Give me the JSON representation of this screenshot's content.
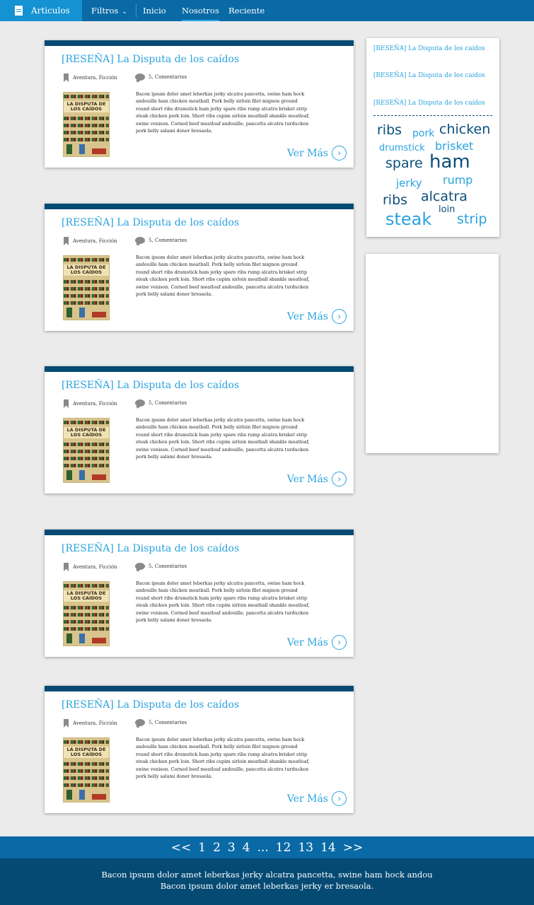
{
  "nav": {
    "brand": "Articulos",
    "filters": "Filtros",
    "items": [
      "Inicio",
      "Nosotros",
      "Reciente"
    ],
    "active": "Nosotros",
    "icons": {
      "brand": "document-icon",
      "filters": "chevron-down-icon"
    }
  },
  "posts": [
    {
      "title": "[RESEÑA] La Disputa de los caídos",
      "category": "Aventura, Ficción",
      "comments": "5, Comentarios",
      "cover_title": "LA DISPUTA DE LOS CAÍDOS",
      "excerpt": "Bacon ipsum dolor amet leberkas jerky alcatra pancetta, swine ham hock andouille ham chicken meatball. Pork belly sirloin filet mignon ground round short ribs drumstick ham jerky spare ribs rump alcatra brisket strip steak chicken pork loin. Short ribs cupim sirloin meatball shankle meatloaf, swine venison. Corned beef meatloaf andouille, pancetta alcatra turducken pork belly salami doner bresaola.",
      "more": "Ver Más"
    },
    {
      "title": "[RESEÑA] La Disputa de los caídos",
      "category": "Aventura, Ficción",
      "comments": "5, Comentarios",
      "cover_title": "LA DISPUTA DE LOS CAÍDOS",
      "excerpt": "Bacon ipsum dolor amet leberkas jerky alcatra pancetta, swine ham hock andouille ham chicken meatball. Pork belly sirloin filet mignon ground round short ribs drumstick ham jerky spare ribs rump alcatra brisket strip steak chicken pork loin. Short ribs cupim sirloin meatball shankle meatloaf, swine venison. Corned beef meatloaf andouille, pancetta alcatra turducken pork belly salami doner bresaola.",
      "more": "Ver Más"
    },
    {
      "title": "[RESEÑA] La Disputa de los caídos",
      "category": "Aventura, Ficción",
      "comments": "5, Comentarios",
      "cover_title": "LA DISPUTA DE LOS CAÍDOS",
      "excerpt": "Bacon ipsum dolor amet leberkas jerky alcatra pancetta, swine ham hock andouille ham chicken meatball. Pork belly sirloin filet mignon ground round short ribs drumstick ham jerky spare ribs rump alcatra brisket strip steak chicken pork loin. Short ribs cupim sirloin meatball shankle meatloaf, swine venison. Corned beef meatloaf andouille, pancetta alcatra turducken pork belly salami doner bresaola.",
      "more": "Ver Más"
    },
    {
      "title": "[RESEÑA] La Disputa de los caídos",
      "category": "Aventura, Ficción",
      "comments": "5, Comentarios",
      "cover_title": "LA DISPUTA DE LOS CAÍDOS",
      "excerpt": "Bacon ipsum dolor amet leberkas jerky alcatra pancetta, swine ham hock andouille ham chicken meatball. Pork belly sirloin filet mignon ground round short ribs drumstick ham jerky spare ribs rump alcatra brisket strip steak chicken pork loin. Short ribs cupim sirloin meatball shankle meatloaf, swine venison. Corned beef meatloaf andouille, pancetta alcatra turducken pork belly salami doner bresaola.",
      "more": "Ver Más"
    },
    {
      "title": "[RESEÑA] La Disputa de los caídos",
      "category": "Aventura, Ficción",
      "comments": "5, Comentarios",
      "cover_title": "LA DISPUTA DE LOS CAÍDOS",
      "excerpt": "Bacon ipsum dolor amet leberkas jerky alcatra pancetta, swine ham hock andouille ham chicken meatball. Pork belly sirloin filet mignon ground round short ribs drumstick ham jerky spare ribs rump alcatra brisket strip steak chicken pork loin. Short ribs cupim sirloin meatball shankle meatloaf, swine venison. Corned beef meatloaf andouille, pancetta alcatra turducken pork belly salami doner bresaola.",
      "more": "Ver Más"
    }
  ],
  "sidebar": {
    "recent": [
      "[RESEÑA] La Disputa de los caídos",
      "[RESEÑA] La Disputa de los caídos",
      "[RESEÑA] La Disputa de los caídos"
    ],
    "tags": [
      "ribs",
      "pork",
      "chicken",
      "drumstick",
      "brisket",
      "spare",
      "ham",
      "jerky",
      "rump",
      "ribs",
      "alcatra",
      "loin",
      "steak",
      "strip"
    ]
  },
  "pagination": [
    "<<",
    "1",
    "2",
    "3",
    "4",
    "...",
    "12",
    "13",
    "14",
    ">>"
  ],
  "footer": {
    "line1": "Bacon ipsum dolor amet leberkas jerky alcatra pancetta, swine ham hock andou",
    "line2": "Bacon ipsum dolor amet leberkas jerky er bresaola."
  },
  "colors": {
    "nav": "#0a6aa5",
    "brand": "#1592d2",
    "card_bar": "#054a73",
    "link": "#2aa3de",
    "footer": "#054a73"
  }
}
